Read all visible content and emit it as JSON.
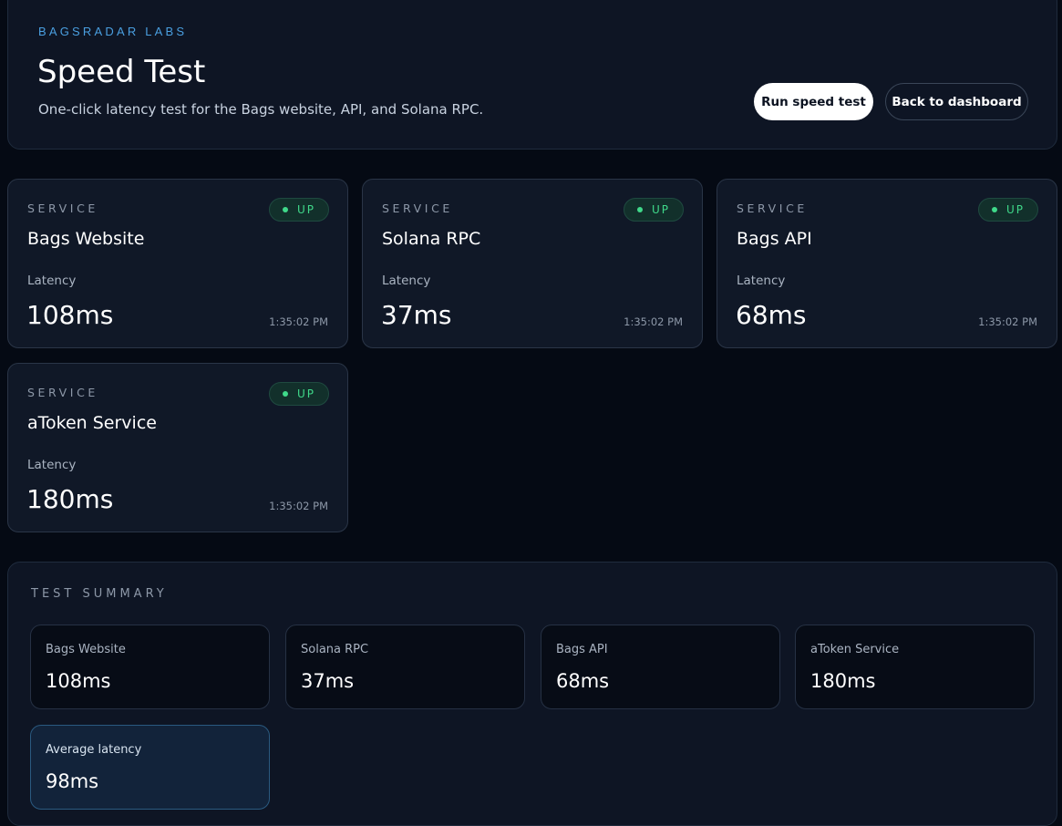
{
  "header": {
    "eyebrow": "BAGSRADAR LABS",
    "title": "Speed Test",
    "subtitle": "One-click latency test for the Bags website, API, and Solana RPC.",
    "run_button": "Run speed test",
    "back_button": "Back to dashboard"
  },
  "services": [
    {
      "label": "SERVICE",
      "status": "UP",
      "name": "Bags Website",
      "latency_label": "Latency",
      "latency": "108ms",
      "time": "1:35:02 PM"
    },
    {
      "label": "SERVICE",
      "status": "UP",
      "name": "Solana RPC",
      "latency_label": "Latency",
      "latency": "37ms",
      "time": "1:35:02 PM"
    },
    {
      "label": "SERVICE",
      "status": "UP",
      "name": "Bags API",
      "latency_label": "Latency",
      "latency": "68ms",
      "time": "1:35:02 PM"
    },
    {
      "label": "SERVICE",
      "status": "UP",
      "name": "aToken Service",
      "latency_label": "Latency",
      "latency": "180ms",
      "time": "1:35:02 PM"
    }
  ],
  "summary": {
    "title": "TEST SUMMARY",
    "items": [
      {
        "label": "Bags Website",
        "value": "108ms"
      },
      {
        "label": "Solana RPC",
        "value": "37ms"
      },
      {
        "label": "Bags API",
        "value": "68ms"
      },
      {
        "label": "aToken Service",
        "value": "180ms"
      }
    ],
    "average": {
      "label": "Average latency",
      "value": "98ms"
    }
  },
  "colors": {
    "accent": "#4a9fe0",
    "status_up": "#3fd98a",
    "background": "#050a14",
    "card": "#101827"
  }
}
